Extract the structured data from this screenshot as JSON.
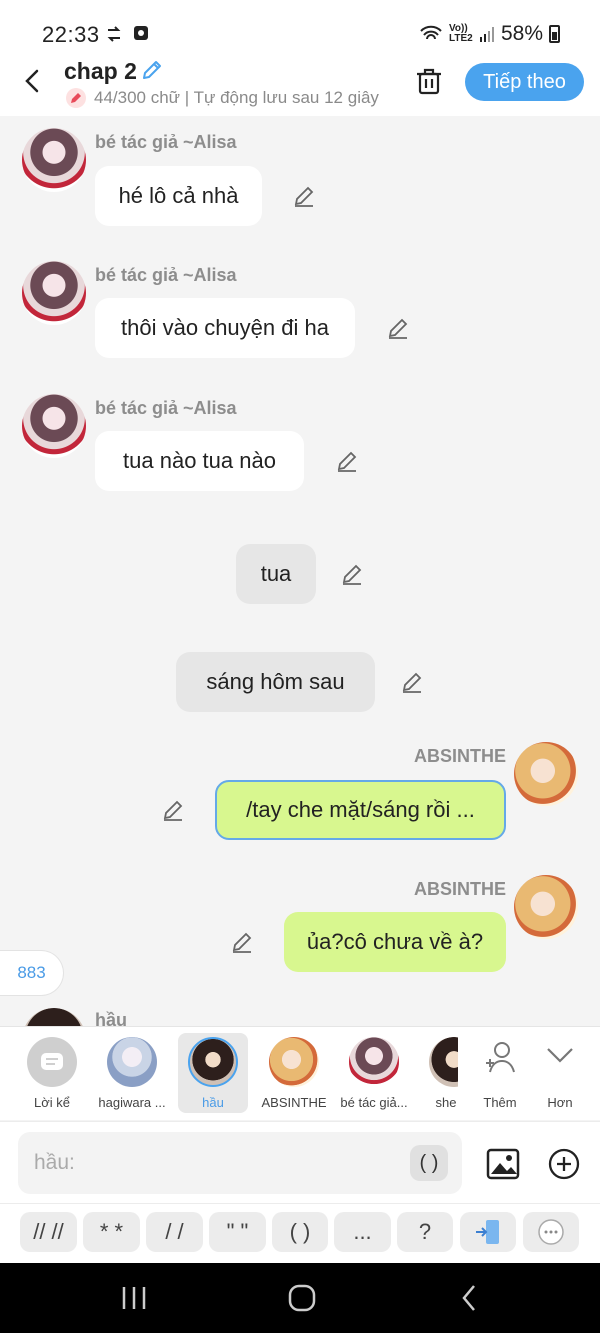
{
  "status_bar": {
    "time": "22:33",
    "network": "Vo)) LTE2",
    "battery": "58%"
  },
  "header": {
    "title": "chap 2",
    "subtitle": "44/300 chữ | Tự động lưu sau 12 giây",
    "next_label": "Tiếp theo"
  },
  "messages": [
    {
      "sender": "bé tác giả ~Alisa",
      "text": "hé lô cả nhà"
    },
    {
      "sender": "bé tác giả ~Alisa",
      "text": "thôi vào chuyện đi ha"
    },
    {
      "sender": "bé tác giả ~Alisa",
      "text": "tua nào tua nào"
    },
    {
      "sender": "",
      "text": "tua"
    },
    {
      "sender": "",
      "text": "sáng hôm sau"
    },
    {
      "sender": "ABSINTHE",
      "text": "/tay che mặt/sáng rồi ..."
    },
    {
      "sender": "ABSINTHE",
      "text": "ủa?cô chưa về à?"
    }
  ],
  "partial_sender": "hầu",
  "counter": "883",
  "characters": [
    {
      "label": "Lời kể"
    },
    {
      "label": "hagiwara ..."
    },
    {
      "label": "hầu"
    },
    {
      "label": "ABSINTHE"
    },
    {
      "label": "bé tác giả..."
    },
    {
      "label": "she"
    }
  ],
  "char_actions": {
    "add_label": "Thêm",
    "more_label": "Hơn"
  },
  "input": {
    "placeholder": "hầu:",
    "paren_label": "( )"
  },
  "shortcuts": [
    "// //",
    "* *",
    "/ /",
    "\" \"",
    "( )",
    "...",
    "?"
  ],
  "colors": {
    "accent": "#4aa3ee",
    "green_bubble": "#d8f78f",
    "gray_bubble": "#e6e6e6"
  }
}
